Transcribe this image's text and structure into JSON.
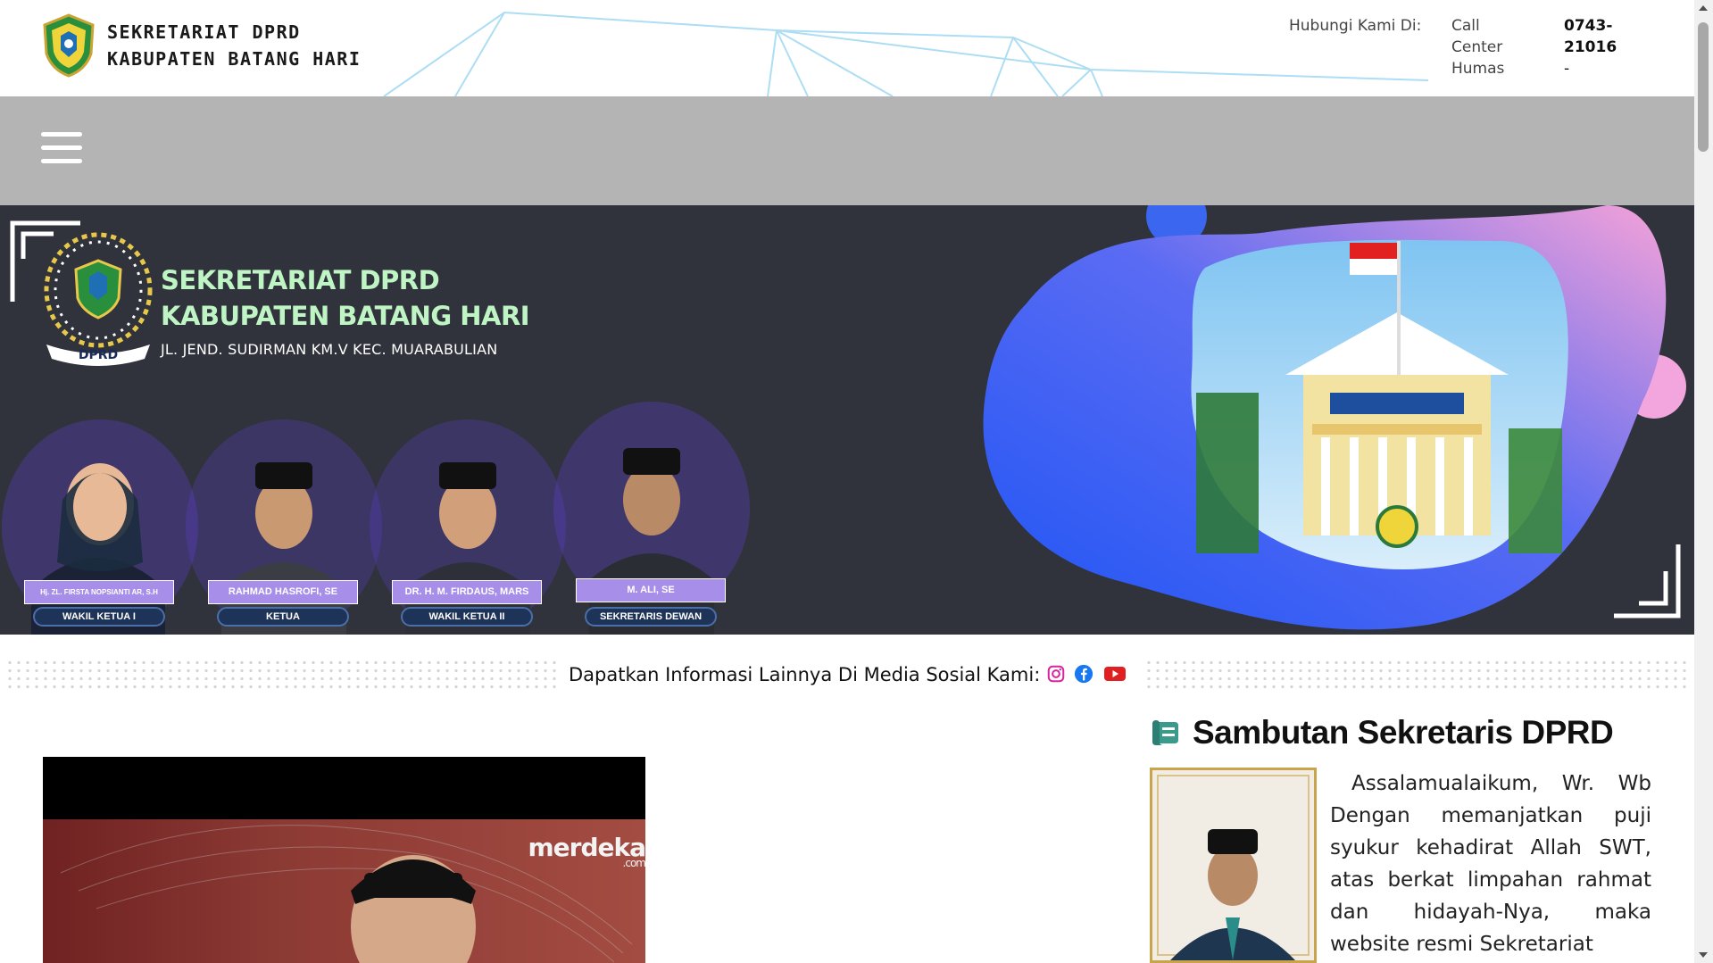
{
  "header": {
    "org_line1": "SEKRETARIAT DPRD",
    "org_line2": "KABUPATEN BATANG HARI",
    "contact_label": "Hubungi Kami Di:",
    "call_center_label": "Call Center",
    "call_center_value": "0743-21016",
    "humas_label": "Humas",
    "humas_value": "-"
  },
  "navbar": {
    "menu_icon": "hamburger-menu-icon"
  },
  "hero": {
    "title_line1": "SEKRETARIAT DPRD",
    "title_line2": "KABUPATEN BATANG HARI",
    "address": "JL. JEND. SUDIRMAN KM.V KEC. MUARABULIAN",
    "emblem_text": "DPRD",
    "members": [
      {
        "name": "Hj. ZL. FIRSTA NOPSIANTI AR, S.H",
        "role": "WAKIL KETUA I"
      },
      {
        "name": "RAHMAD HASROFI, SE",
        "role": "KETUA"
      },
      {
        "name": "DR. H. M. FIRDAUS, MARS",
        "role": "WAKIL KETUA II"
      },
      {
        "name": "M. ALI, SE",
        "role": "SEKRETARIS DEWAN"
      }
    ],
    "colors": {
      "background": "#30333b",
      "title": "#bff5c4",
      "blob_blue": "#2f62f2",
      "blob_pink": "#f1a1dc"
    }
  },
  "social": {
    "caption": "Dapatkan Informasi Lainnya Di Media Sosial Kami:",
    "icons": [
      "instagram-icon",
      "facebook-icon",
      "youtube-icon"
    ],
    "colors": {
      "instagram": "#d6249f",
      "facebook": "#1877f2",
      "youtube": "#e02020"
    }
  },
  "video": {
    "watermark": "merdeka",
    "watermark_suffix": ".com"
  },
  "sidebar": {
    "title": "Sambutan Sekretaris DPRD",
    "title_icon": "scroll-icon",
    "greeting": "Assalamualaikum, Wr. Wb Dengan memanjatkan puji syukur kehadirat Allah SWT, atas berkat limpahan rahmat dan hidayah-Nya, maka website resmi Sekretariat"
  }
}
